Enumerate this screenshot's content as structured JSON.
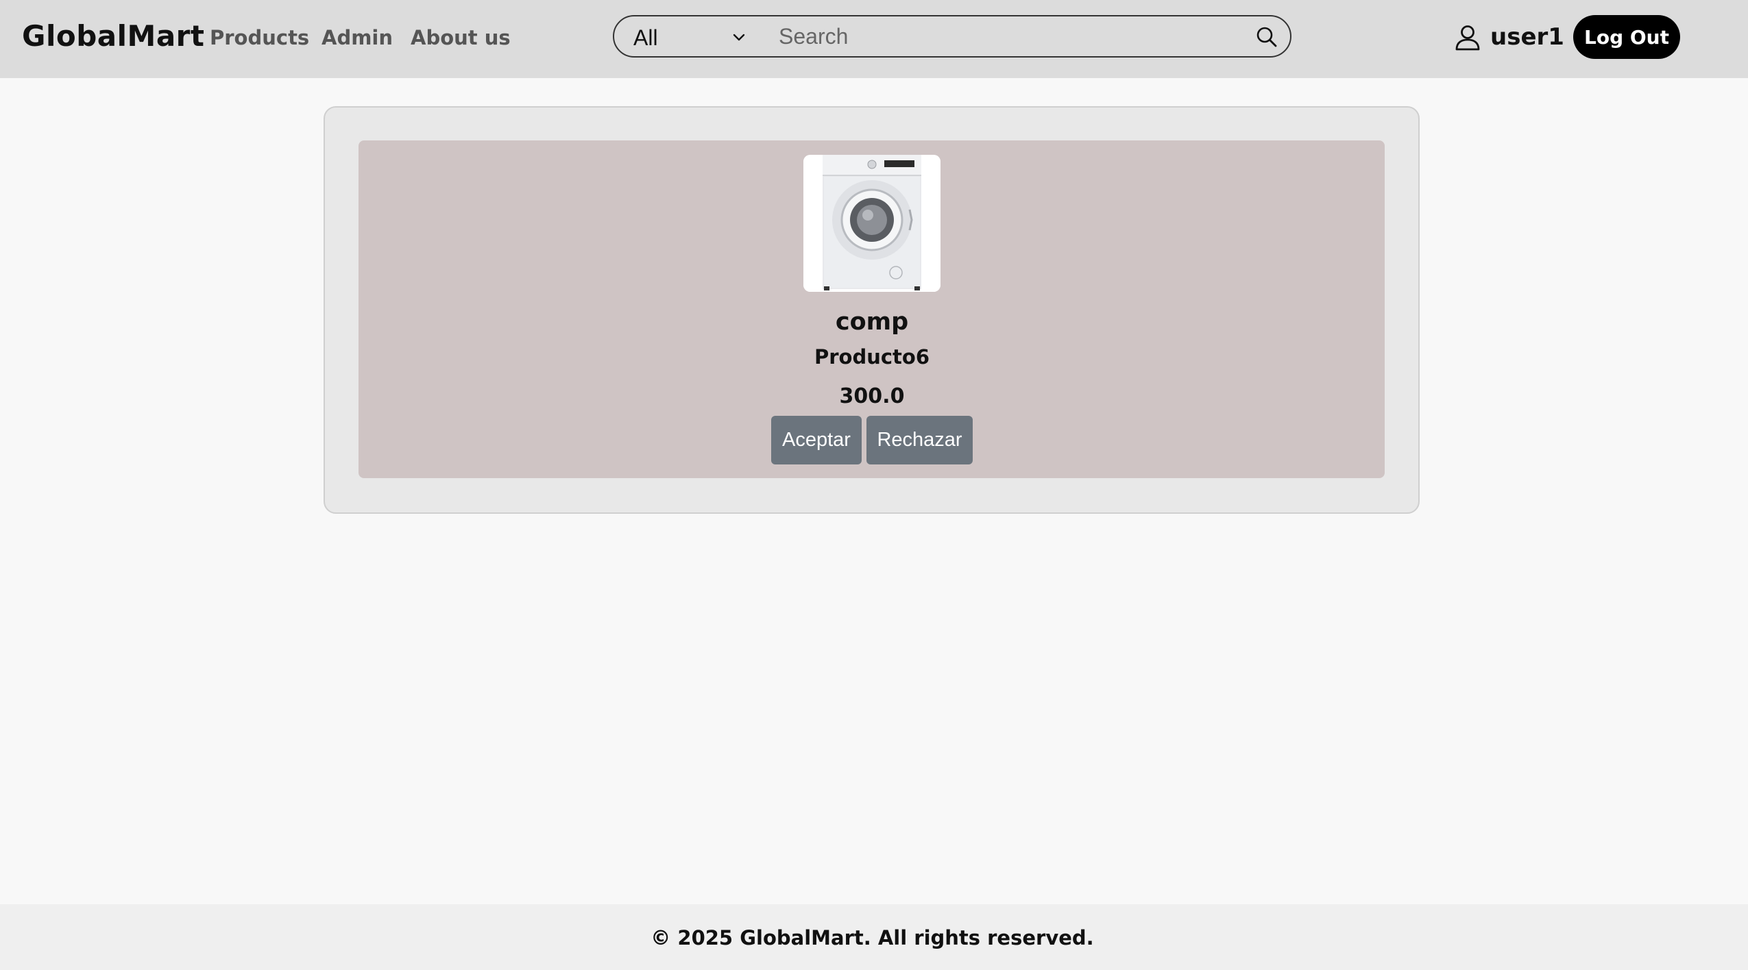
{
  "header": {
    "brand": "GlobalMart",
    "nav": {
      "products": "Products",
      "admin": "Admin",
      "about": "About us"
    },
    "search": {
      "category": "All",
      "placeholder": "Search"
    },
    "user": {
      "name": "user1",
      "logout_label": "Log Out"
    }
  },
  "product": {
    "title": "comp",
    "name": "Producto6",
    "price": "300.0",
    "image": "washing-machine",
    "accept_label": "Aceptar",
    "reject_label": "Rechazar"
  },
  "footer": {
    "text": "© 2025 GlobalMart. All rights reserved."
  },
  "colors": {
    "header_bg": "#dcdcdc",
    "card_bg": "#cfc4c4",
    "button_bg": "#6b747d",
    "logout_bg": "#000000"
  }
}
